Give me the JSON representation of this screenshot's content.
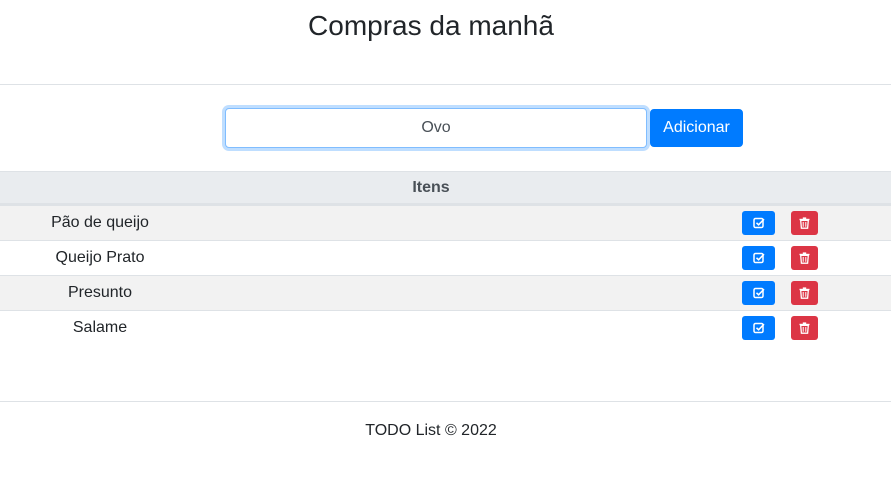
{
  "header": {
    "title": "Compras da manhã"
  },
  "form": {
    "input_value": "Ovo",
    "add_label": "Adicionar"
  },
  "table": {
    "column_header": "Itens",
    "items": [
      {
        "label": "Pão de queijo"
      },
      {
        "label": "Queijo Prato"
      },
      {
        "label": "Presunto"
      },
      {
        "label": "Salame"
      }
    ]
  },
  "footer": {
    "text": "TODO List © 2022"
  },
  "colors": {
    "primary": "#007bff",
    "danger": "#dc3545",
    "table_head": "#e9ecef",
    "stripe": "#f2f2f2"
  },
  "icons": {
    "check": "check-square-icon",
    "delete": "trash-icon"
  }
}
